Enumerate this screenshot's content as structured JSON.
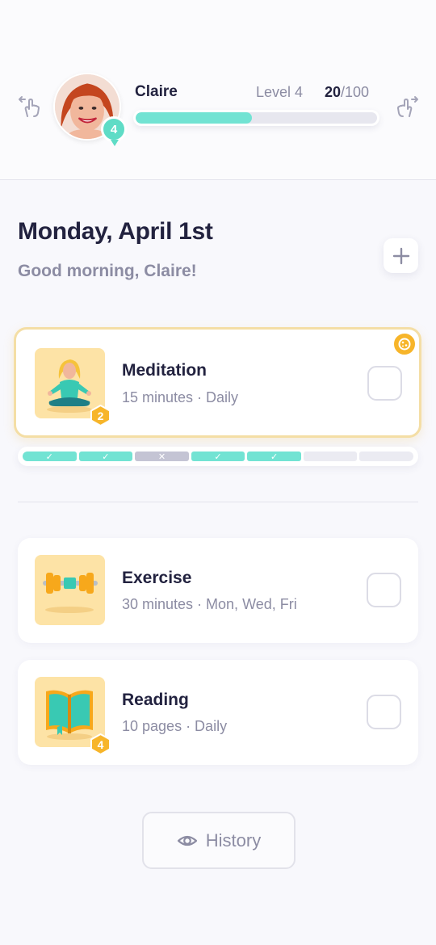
{
  "header": {
    "user_name": "Claire",
    "avatar_level": "4",
    "level_label": "Level 4",
    "xp_current": "20",
    "xp_max": "/100",
    "xp_progress": 0.48,
    "icons": {
      "left": "swipe-left-hand-icon",
      "right": "swipe-right-hand-icon"
    }
  },
  "main": {
    "date_title": "Monday, April 1st",
    "greeting": "Good morning, Claire!",
    "add_icon": "plus-icon"
  },
  "habits": [
    {
      "title": "Meditation",
      "subtitle": "15 minutes · Daily",
      "badge": "2",
      "icon": "meditation-icon",
      "checked": false,
      "active": true
    },
    {
      "title": "Exercise",
      "subtitle": "30 minutes · Mon, Wed, Fri",
      "badge": "",
      "icon": "dumbbell-icon",
      "checked": false,
      "active": false
    },
    {
      "title": "Reading",
      "subtitle": "10 pages · Daily",
      "badge": "4",
      "icon": "book-icon",
      "checked": false,
      "active": false
    }
  ],
  "streak": {
    "days": [
      {
        "status": "done",
        "mark": "✓"
      },
      {
        "status": "done",
        "mark": "✓"
      },
      {
        "status": "miss",
        "mark": "✕"
      },
      {
        "status": "done",
        "mark": "✓"
      },
      {
        "status": "done",
        "mark": "✓"
      },
      {
        "status": "empty",
        "mark": ""
      },
      {
        "status": "empty",
        "mark": ""
      }
    ]
  },
  "footer": {
    "history_label": "History",
    "history_icon": "eye-icon"
  },
  "colors": {
    "accent": "#72e3d3",
    "badge": "#f7b52a",
    "thumb_bg": "#fde3a6",
    "muted_text": "#8c8ca3",
    "dark_text": "#22223f"
  }
}
